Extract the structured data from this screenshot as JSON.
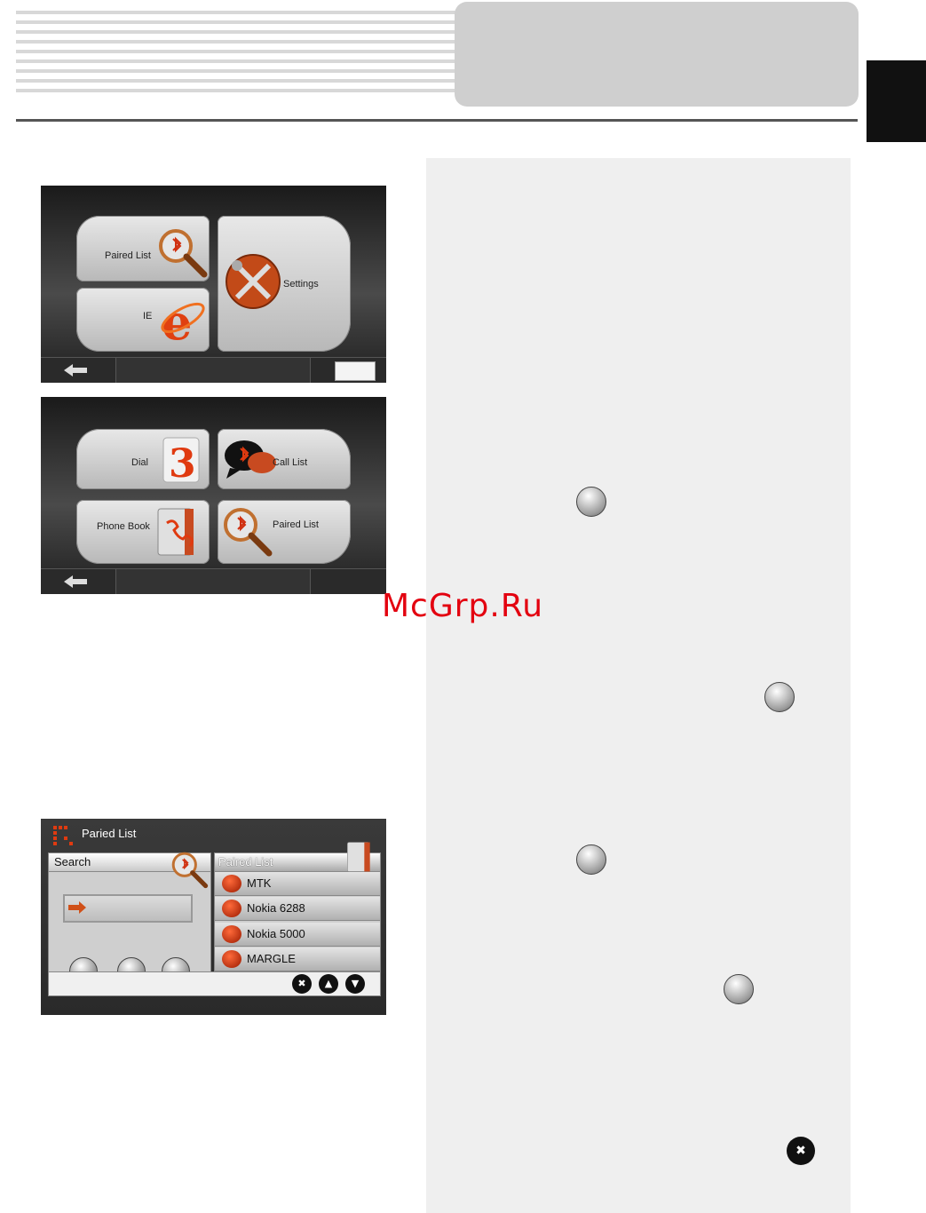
{
  "watermark": "McGrp.Ru",
  "screen1": {
    "tiles": {
      "paired_list": "Paired List",
      "settings": "Settings",
      "ie": "IE"
    }
  },
  "screen2": {
    "tiles": {
      "dial": "Dial",
      "call_list": "Call List",
      "phone_book": "Phone Book",
      "paired_list": "Paired List"
    }
  },
  "screen3": {
    "title": "Paried List",
    "search_label": "Search",
    "paired_header": "Paired List",
    "devices": [
      "MTK",
      "Nokia 6288",
      "Nokia 5000",
      "MARGLE"
    ],
    "toolbar_icons": [
      "connect-icon",
      "disconnect-icon",
      "search-bt-icon"
    ],
    "nav_icons": [
      "close-icon",
      "up-icon",
      "down-icon"
    ]
  },
  "inline_icons": [
    "bluetooth-search-icon",
    "connect-icon",
    "disconnect-icon",
    "connect-icon",
    "close-icon"
  ],
  "colors": {
    "accent": "#e3000f",
    "panel": "#efefef",
    "header_box": "#cfcfcf"
  }
}
